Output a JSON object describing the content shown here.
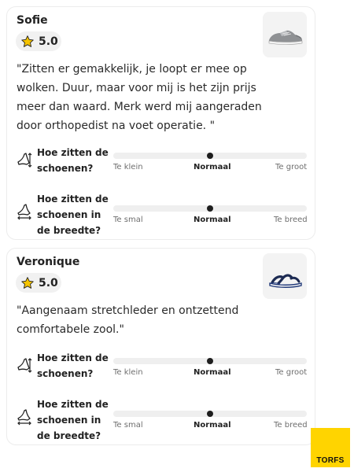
{
  "reviews": [
    {
      "name": "Sofie",
      "rating": "5.0",
      "quote": "\"Zitten er gemakkelijk, je loopt er mee op wolken. Duur, maar voor mij is het zijn prijs meer dan waard. Merk werd mij aangeraden door orthopedist na voet operatie. \"",
      "product_icon": "silver-sneaker",
      "fit": [
        {
          "question": "Hoe zitten de schoenen?",
          "icon": "length-fit-icon",
          "min": "Te klein",
          "mid": "Normaal",
          "max": "Te groot",
          "value": 0.5
        },
        {
          "question": "Hoe zitten de schoenen in de breedte?",
          "icon": "width-fit-icon",
          "min": "Te smal",
          "mid": "Normaal",
          "max": "Te breed",
          "value": 0.5
        }
      ]
    },
    {
      "name": "Veronique",
      "rating": "5.0",
      "quote": "\"Aangenaam stretchleder en ontzettend comfortabele zool.\"",
      "product_icon": "navy-sandal",
      "fit": [
        {
          "question": "Hoe zitten de schoenen?",
          "icon": "length-fit-icon",
          "min": "Te klein",
          "mid": "Normaal",
          "max": "Te groot",
          "value": 0.5
        },
        {
          "question": "Hoe zitten de schoenen in de breedte?",
          "icon": "width-fit-icon",
          "min": "Te smal",
          "mid": "Normaal",
          "max": "Te breed",
          "value": 0.5
        }
      ]
    }
  ],
  "logo": {
    "text": "TORFS",
    "color": "#ffd400"
  },
  "colors": {
    "star": "#f6c400",
    "track": "#efefef",
    "indicator": "#1e1e1e"
  }
}
